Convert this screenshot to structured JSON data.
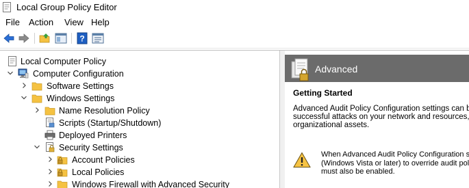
{
  "window": {
    "title": "Local Group Policy Editor"
  },
  "menu": [
    "File",
    "Action",
    "View",
    "Help"
  ],
  "toolbar": {
    "buttons": [
      "back-arrow-icon",
      "forward-arrow-icon",
      "up-folder-icon",
      "show-hide-tree-icon",
      "help-icon",
      "properties-icon"
    ]
  },
  "tree": {
    "root": "Local Computer Policy",
    "computer_config": "Computer Configuration",
    "software_settings": "Software Settings",
    "windows_settings": "Windows Settings",
    "name_resolution": "Name Resolution Policy",
    "scripts": "Scripts (Startup/Shutdown)",
    "deployed_printers": "Deployed Printers",
    "security_settings": "Security Settings",
    "account_policies": "Account Policies",
    "local_policies": "Local Policies",
    "windows_firewall": "Windows Firewall with Advanced Security"
  },
  "detail": {
    "header": "Advanced",
    "section_title": "Getting Started",
    "description_lines": [
      "Advanced Audit Policy Configuration settings can be u",
      "successful attacks on your network and resources, and",
      "organizational assets."
    ],
    "warning_lines": [
      "When Advanced Audit Policy Configuration se",
      "(Windows Vista or later) to override audit polic",
      "must also be enabled."
    ]
  },
  "colors": {
    "accent": "#0063b1",
    "folder": "#f5c242",
    "header_bg": "#6b6b6b"
  }
}
